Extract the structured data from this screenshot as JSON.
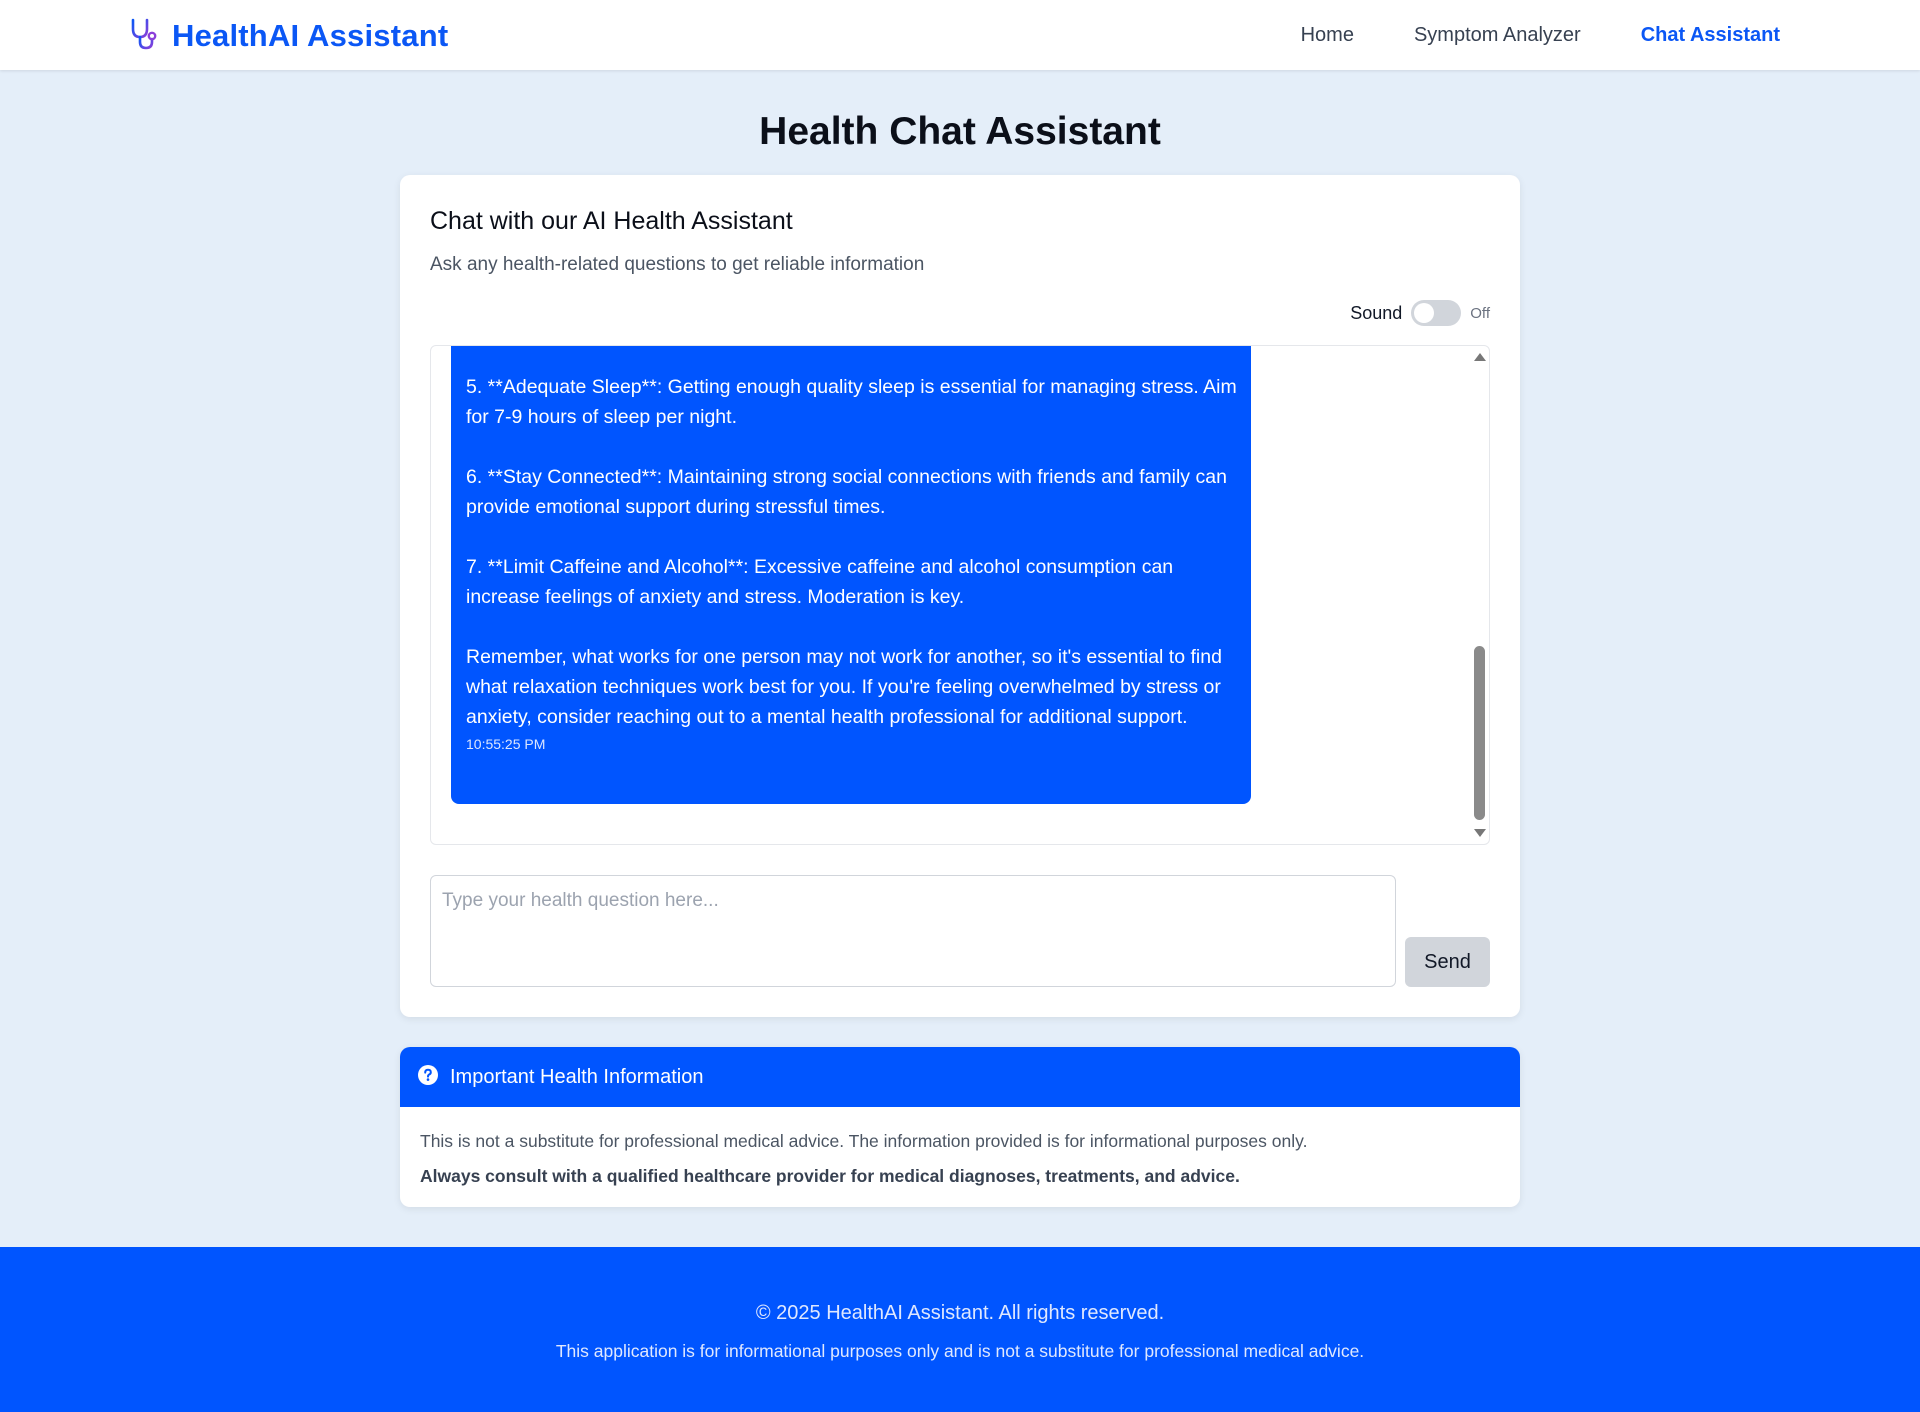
{
  "app": {
    "brand": "HealthAI Assistant",
    "brand_icon": "stethoscope-icon",
    "accent_color": "#0055ff"
  },
  "nav": {
    "items": [
      {
        "label": "Home",
        "active": false
      },
      {
        "label": "Symptom Analyzer",
        "active": false
      },
      {
        "label": "Chat Assistant",
        "active": true
      }
    ]
  },
  "page": {
    "title": "Health Chat Assistant"
  },
  "chat": {
    "title": "Chat with our AI Health Assistant",
    "subtitle": "Ask any health-related questions to get reliable information",
    "sound_label": "Sound",
    "sound_state": "Off",
    "messages": [
      {
        "sender": "assistant",
        "paragraphs": [
          "5. **Adequate Sleep**: Getting enough quality sleep is essential for managing stress. Aim for 7-9 hours of sleep per night.",
          "6. **Stay Connected**: Maintaining strong social connections with friends and family can provide emotional support during stressful times.",
          "7. **Limit Caffeine and Alcohol**: Excessive caffeine and alcohol consumption can increase feelings of anxiety and stress. Moderation is key.",
          "Remember, what works for one person may not work for another, so it's essential to find what relaxation techniques work best for you. If you're feeling overwhelmed by stress or anxiety, consider reaching out to a mental health professional for additional support."
        ],
        "timestamp": "10:55:25 PM"
      }
    ],
    "input_placeholder": "Type your health question here...",
    "input_value": "",
    "send_label": "Send"
  },
  "info": {
    "icon": "question-circle-icon",
    "title": "Important Health Information",
    "line1": "This is not a substitute for professional medical advice. The information provided is for informational purposes only.",
    "line2": "Always consult with a qualified healthcare provider for medical diagnoses, treatments, and advice."
  },
  "footer": {
    "copyright": "© 2025 HealthAI Assistant. All rights reserved.",
    "note": "This application is for informational purposes only and is not a substitute for professional medical advice."
  }
}
